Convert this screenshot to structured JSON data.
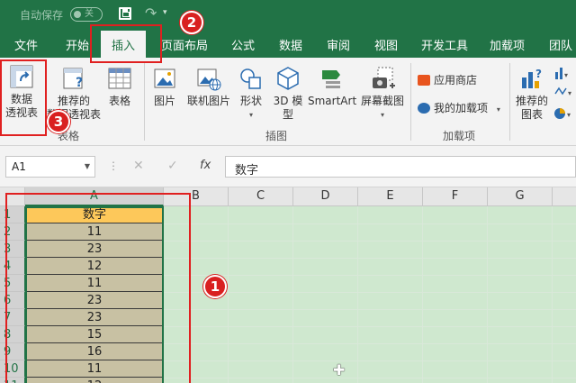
{
  "titlebar": {
    "autosave_label": "自动保存",
    "autosave_state": "关"
  },
  "tabs": [
    "文件",
    "开始",
    "插入",
    "页面布局",
    "公式",
    "数据",
    "审阅",
    "视图",
    "开发工具",
    "加载项",
    "团队"
  ],
  "active_tab": "插入",
  "ribbon": {
    "pivot_table": "数据\n透视表",
    "pivot_table_l1": "数据",
    "pivot_table_l2": "透视表",
    "recommended_pivot_l1": "推荐的",
    "recommended_pivot_l2": "数据透视表",
    "table": "表格",
    "group_tables": "表格",
    "picture": "图片",
    "online_picture": "联机图片",
    "shapes": "形状",
    "model3d_l1": "3D 模",
    "model3d_l2": "型",
    "smartart": "SmartArt",
    "screenshot": "屏幕截图",
    "group_illustrations": "插图",
    "app_store": "应用商店",
    "my_addins": "我的加载项",
    "group_addins": "加载项",
    "recommended_charts_l1": "推荐的",
    "recommended_charts_l2": "图表"
  },
  "formula_bar": {
    "name_box": "A1",
    "fx": "fx",
    "content": "数字"
  },
  "columns": [
    "A",
    "B",
    "C",
    "D",
    "E",
    "F",
    "G"
  ],
  "rows": [
    {
      "num": "1",
      "value": "数字"
    },
    {
      "num": "2",
      "value": "11"
    },
    {
      "num": "3",
      "value": "23"
    },
    {
      "num": "4",
      "value": "12"
    },
    {
      "num": "5",
      "value": "11"
    },
    {
      "num": "6",
      "value": "23"
    },
    {
      "num": "7",
      "value": "23"
    },
    {
      "num": "8",
      "value": "15"
    },
    {
      "num": "9",
      "value": "16"
    },
    {
      "num": "10",
      "value": "11"
    },
    {
      "num": "11",
      "value": "12"
    }
  ],
  "annotations": [
    "1",
    "2",
    "3"
  ],
  "colors": {
    "excel_green": "#217346",
    "header_cell": "#fdc85a",
    "data_cell": "#c8c1a3",
    "annotation_red": "#e02020"
  }
}
